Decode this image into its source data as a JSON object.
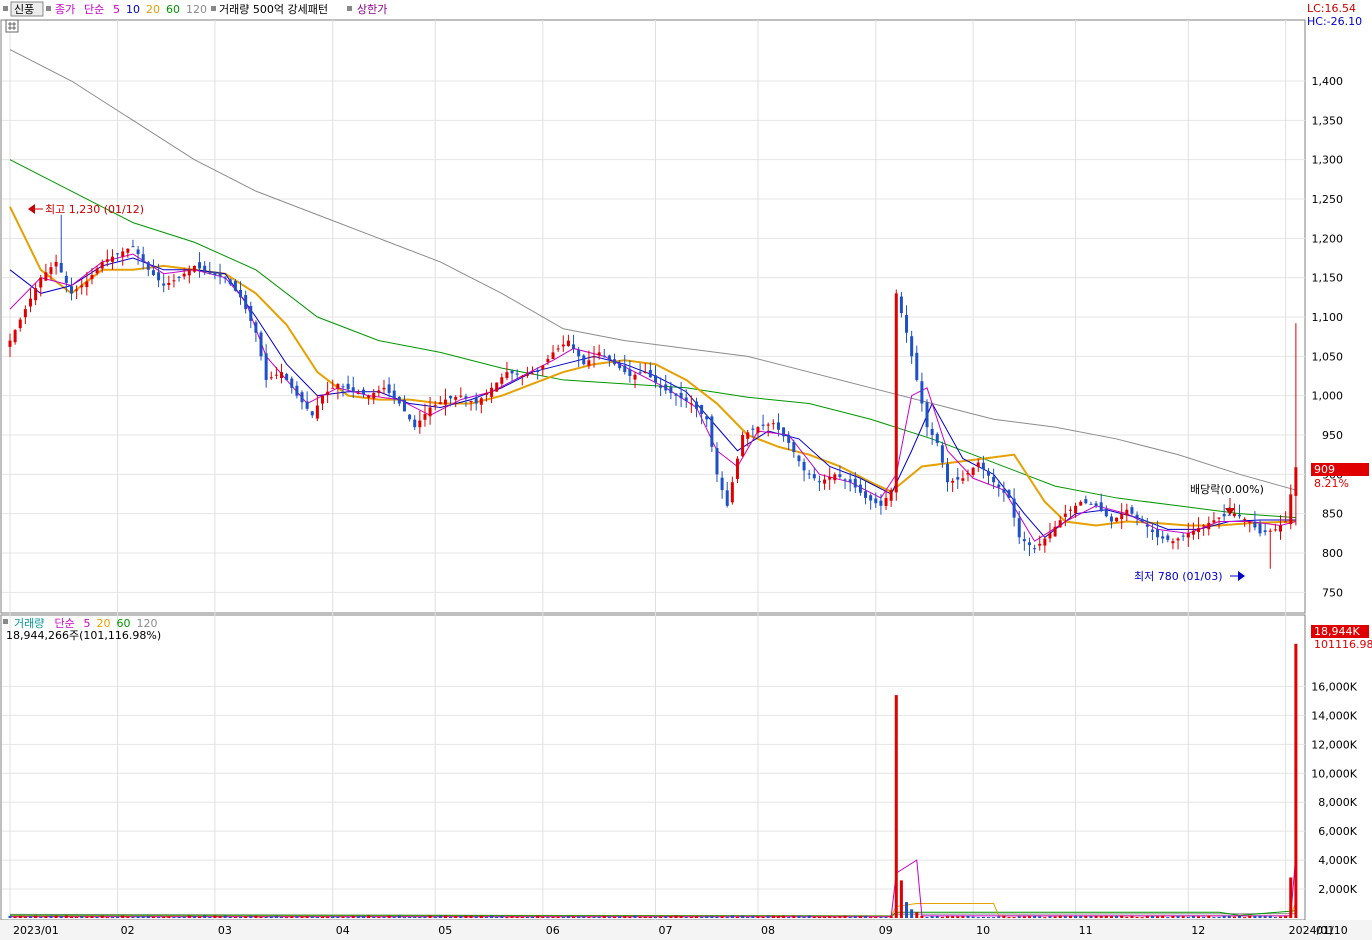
{
  "header": {
    "stock_name": "신풍",
    "price_legend": [
      {
        "text": "종가",
        "color": "#c800c8"
      },
      {
        "text": "단순",
        "color": "#c800c8"
      },
      {
        "text": "5",
        "color": "#c800c8"
      },
      {
        "text": "10",
        "color": "#0000c8"
      },
      {
        "text": "20",
        "color": "#e6a000"
      },
      {
        "text": "60",
        "color": "#009600"
      },
      {
        "text": "120",
        "color": "#8c8c8c"
      }
    ],
    "volume_pattern": "거래량 500억 강세패턴",
    "upper_limit": "상한가",
    "lc": "LC:16.54",
    "hc": "HC:-26.10"
  },
  "volume_header": {
    "legend": [
      {
        "text": "거래량",
        "color": "#009696"
      },
      {
        "text": "단순",
        "color": "#c800c8"
      },
      {
        "text": "5",
        "color": "#c800c8"
      },
      {
        "text": "20",
        "color": "#e6a000"
      },
      {
        "text": "60",
        "color": "#009600"
      },
      {
        "text": "120",
        "color": "#8c8c8c"
      }
    ],
    "current": "18,944,266주(101,116.98%)"
  },
  "annotations": {
    "high": "최고 1,230 (01/12)",
    "low": "최저 780 (01/03)",
    "dividend": "배당락(0.00%)",
    "current_price": "909",
    "current_change": "8.21%",
    "current_volume": "18,944K",
    "current_volume_pct": "101116.98"
  },
  "chart_data": [
    {
      "type": "candlestick",
      "title": "",
      "ylim": [
        725,
        1475
      ],
      "y_ticks": [
        "750",
        "800",
        "850",
        "900",
        "950",
        "1,000",
        "1,050",
        "1,100",
        "1,150",
        "1,200",
        "1,250",
        "1,300",
        "1,350",
        "1,400"
      ],
      "x_ticks": [
        "2023/01",
        "02",
        "03",
        "04",
        "05",
        "06",
        "07",
        "08",
        "09",
        "10",
        "11",
        "12",
        "2024/01",
        "01/10"
      ],
      "anchors": [
        [
          0,
          1070
        ],
        [
          3,
          1110
        ],
        [
          6,
          1150
        ],
        [
          9,
          1170
        ],
        [
          12,
          1130
        ],
        [
          15,
          1145
        ],
        [
          18,
          1170
        ],
        [
          21,
          1180
        ],
        [
          24,
          1190
        ],
        [
          27,
          1160
        ],
        [
          30,
          1140
        ],
        [
          33,
          1150
        ],
        [
          36,
          1165
        ],
        [
          39,
          1155
        ],
        [
          42,
          1150
        ],
        [
          45,
          1125
        ],
        [
          48,
          1080
        ],
        [
          50,
          1020
        ],
        [
          53,
          1030
        ],
        [
          56,
          1000
        ],
        [
          59,
          975
        ],
        [
          61,
          1000
        ],
        [
          64,
          1015
        ],
        [
          67,
          1005
        ],
        [
          70,
          1000
        ],
        [
          73,
          1010
        ],
        [
          76,
          990
        ],
        [
          79,
          960
        ],
        [
          82,
          985
        ],
        [
          85,
          995
        ],
        [
          88,
          1000
        ],
        [
          91,
          990
        ],
        [
          94,
          1010
        ],
        [
          97,
          1030
        ],
        [
          100,
          1025
        ],
        [
          103,
          1030
        ],
        [
          106,
          1055
        ],
        [
          109,
          1070
        ],
        [
          112,
          1040
        ],
        [
          115,
          1055
        ],
        [
          118,
          1040
        ],
        [
          121,
          1025
        ],
        [
          124,
          1030
        ],
        [
          127,
          1010
        ],
        [
          130,
          1000
        ],
        [
          133,
          990
        ],
        [
          136,
          970
        ],
        [
          138,
          900
        ],
        [
          140,
          860
        ],
        [
          143,
          950
        ],
        [
          146,
          960
        ],
        [
          149,
          965
        ],
        [
          152,
          940
        ],
        [
          155,
          905
        ],
        [
          158,
          890
        ],
        [
          161,
          900
        ],
        [
          164,
          890
        ],
        [
          167,
          870
        ],
        [
          170,
          860
        ],
        [
          172,
          880
        ],
        [
          173,
          1130
        ],
        [
          175,
          1080
        ],
        [
          177,
          1020
        ],
        [
          179,
          960
        ],
        [
          181,
          940
        ],
        [
          183,
          890
        ],
        [
          186,
          895
        ],
        [
          189,
          915
        ],
        [
          192,
          890
        ],
        [
          195,
          870
        ],
        [
          197,
          820
        ],
        [
          200,
          805
        ],
        [
          203,
          825
        ],
        [
          206,
          850
        ],
        [
          209,
          865
        ],
        [
          212,
          860
        ],
        [
          215,
          840
        ],
        [
          218,
          855
        ],
        [
          221,
          840
        ],
        [
          224,
          820
        ],
        [
          227,
          815
        ],
        [
          230,
          825
        ],
        [
          233,
          835
        ],
        [
          236,
          845
        ],
        [
          239,
          850
        ],
        [
          242,
          840
        ],
        [
          244,
          825
        ],
        [
          247,
          830
        ],
        [
          249,
          840
        ],
        [
          251,
          909
        ]
      ],
      "ma5": [
        [
          0,
          1110
        ],
        [
          6,
          1150
        ],
        [
          12,
          1140
        ],
        [
          18,
          1170
        ],
        [
          24,
          1180
        ],
        [
          30,
          1155
        ],
        [
          36,
          1160
        ],
        [
          42,
          1150
        ],
        [
          46,
          1120
        ],
        [
          50,
          1050
        ],
        [
          54,
          1020
        ],
        [
          58,
          990
        ],
        [
          64,
          1010
        ],
        [
          70,
          1000
        ],
        [
          76,
          995
        ],
        [
          82,
          975
        ],
        [
          88,
          995
        ],
        [
          94,
          1005
        ],
        [
          100,
          1025
        ],
        [
          106,
          1045
        ],
        [
          110,
          1060
        ],
        [
          116,
          1050
        ],
        [
          122,
          1030
        ],
        [
          128,
          1010
        ],
        [
          134,
          985
        ],
        [
          138,
          930
        ],
        [
          142,
          910
        ],
        [
          146,
          955
        ],
        [
          152,
          950
        ],
        [
          158,
          900
        ],
        [
          164,
          890
        ],
        [
          170,
          870
        ],
        [
          173,
          900
        ],
        [
          176,
          1000
        ],
        [
          179,
          1010
        ],
        [
          183,
          930
        ],
        [
          188,
          895
        ],
        [
          194,
          880
        ],
        [
          200,
          815
        ],
        [
          206,
          840
        ],
        [
          212,
          860
        ],
        [
          218,
          850
        ],
        [
          224,
          830
        ],
        [
          230,
          825
        ],
        [
          236,
          840
        ],
        [
          242,
          840
        ],
        [
          248,
          835
        ],
        [
          251,
          840
        ]
      ],
      "ma10": [
        [
          0,
          1160
        ],
        [
          6,
          1130
        ],
        [
          12,
          1140
        ],
        [
          18,
          1165
        ],
        [
          24,
          1175
        ],
        [
          30,
          1160
        ],
        [
          36,
          1160
        ],
        [
          42,
          1155
        ],
        [
          48,
          1100
        ],
        [
          54,
          1040
        ],
        [
          60,
          1000
        ],
        [
          66,
          1005
        ],
        [
          72,
          1005
        ],
        [
          78,
          990
        ],
        [
          84,
          985
        ],
        [
          90,
          995
        ],
        [
          96,
          1010
        ],
        [
          102,
          1030
        ],
        [
          108,
          1040
        ],
        [
          114,
          1050
        ],
        [
          120,
          1040
        ],
        [
          126,
          1025
        ],
        [
          132,
          1005
        ],
        [
          138,
          960
        ],
        [
          142,
          930
        ],
        [
          148,
          955
        ],
        [
          154,
          945
        ],
        [
          160,
          910
        ],
        [
          166,
          895
        ],
        [
          172,
          875
        ],
        [
          176,
          930
        ],
        [
          180,
          990
        ],
        [
          186,
          920
        ],
        [
          192,
          900
        ],
        [
          198,
          850
        ],
        [
          202,
          820
        ],
        [
          208,
          850
        ],
        [
          214,
          855
        ],
        [
          220,
          845
        ],
        [
          226,
          830
        ],
        [
          232,
          830
        ],
        [
          238,
          840
        ],
        [
          244,
          842
        ],
        [
          251,
          842
        ]
      ],
      "ma20": [
        [
          0,
          1240
        ],
        [
          6,
          1160
        ],
        [
          12,
          1130
        ],
        [
          18,
          1160
        ],
        [
          24,
          1160
        ],
        [
          30,
          1165
        ],
        [
          36,
          1160
        ],
        [
          42,
          1155
        ],
        [
          48,
          1130
        ],
        [
          54,
          1090
        ],
        [
          60,
          1030
        ],
        [
          66,
          1000
        ],
        [
          72,
          995
        ],
        [
          78,
          995
        ],
        [
          84,
          990
        ],
        [
          90,
          990
        ],
        [
          96,
          1000
        ],
        [
          102,
          1015
        ],
        [
          108,
          1030
        ],
        [
          114,
          1040
        ],
        [
          120,
          1045
        ],
        [
          126,
          1040
        ],
        [
          132,
          1020
        ],
        [
          138,
          990
        ],
        [
          144,
          950
        ],
        [
          150,
          935
        ],
        [
          156,
          925
        ],
        [
          162,
          910
        ],
        [
          168,
          890
        ],
        [
          172,
          878
        ],
        [
          178,
          910
        ],
        [
          184,
          915
        ],
        [
          190,
          920
        ],
        [
          196,
          925
        ],
        [
          202,
          865
        ],
        [
          206,
          840
        ],
        [
          212,
          835
        ],
        [
          218,
          840
        ],
        [
          224,
          838
        ],
        [
          230,
          835
        ],
        [
          236,
          835
        ],
        [
          242,
          838
        ],
        [
          251,
          840
        ]
      ],
      "ma60": [
        [
          0,
          1300
        ],
        [
          12,
          1260
        ],
        [
          24,
          1220
        ],
        [
          36,
          1195
        ],
        [
          48,
          1160
        ],
        [
          60,
          1100
        ],
        [
          72,
          1070
        ],
        [
          84,
          1055
        ],
        [
          96,
          1035
        ],
        [
          108,
          1020
        ],
        [
          120,
          1015
        ],
        [
          132,
          1010
        ],
        [
          144,
          998
        ],
        [
          156,
          990
        ],
        [
          168,
          970
        ],
        [
          180,
          945
        ],
        [
          192,
          915
        ],
        [
          204,
          885
        ],
        [
          216,
          870
        ],
        [
          228,
          860
        ],
        [
          240,
          850
        ],
        [
          251,
          845
        ]
      ],
      "ma120": [
        [
          0,
          1440
        ],
        [
          12,
          1400
        ],
        [
          24,
          1350
        ],
        [
          36,
          1300
        ],
        [
          48,
          1260
        ],
        [
          60,
          1230
        ],
        [
          72,
          1200
        ],
        [
          84,
          1170
        ],
        [
          96,
          1130
        ],
        [
          108,
          1085
        ],
        [
          120,
          1070
        ],
        [
          132,
          1060
        ],
        [
          144,
          1050
        ],
        [
          156,
          1030
        ],
        [
          168,
          1010
        ],
        [
          180,
          990
        ],
        [
          192,
          970
        ],
        [
          204,
          960
        ],
        [
          216,
          945
        ],
        [
          228,
          925
        ],
        [
          240,
          900
        ],
        [
          251,
          880
        ]
      ]
    },
    {
      "type": "bar",
      "title": "",
      "ylim": [
        0,
        19000
      ],
      "y_ticks": [
        "2,000K",
        "4,000K",
        "6,000K",
        "8,000K",
        "10,000K",
        "12,000K",
        "14,000K",
        "16,000K"
      ],
      "spikes": [
        [
          173,
          15400
        ],
        [
          174,
          2600
        ],
        [
          175,
          1100
        ],
        [
          176,
          600
        ],
        [
          177,
          400
        ],
        [
          250,
          2800
        ],
        [
          251,
          18944
        ]
      ],
      "ma5_vol": [
        [
          0,
          90
        ],
        [
          172,
          90
        ],
        [
          173,
          3100
        ],
        [
          177,
          4000
        ],
        [
          178,
          150
        ],
        [
          250,
          150
        ],
        [
          251,
          4400
        ]
      ],
      "ma20_vol": [
        [
          0,
          120
        ],
        [
          172,
          120
        ],
        [
          173,
          800
        ],
        [
          177,
          1000
        ],
        [
          192,
          1000
        ],
        [
          193,
          150
        ],
        [
          250,
          150
        ],
        [
          251,
          1100
        ]
      ],
      "ma60_vol": [
        [
          0,
          200
        ],
        [
          172,
          150
        ],
        [
          173,
          400
        ],
        [
          236,
          400
        ],
        [
          240,
          180
        ],
        [
          251,
          500
        ]
      ],
      "ma120_vol": [
        [
          0,
          250
        ],
        [
          100,
          180
        ],
        [
          172,
          150
        ],
        [
          173,
          260
        ],
        [
          251,
          300
        ]
      ]
    }
  ]
}
